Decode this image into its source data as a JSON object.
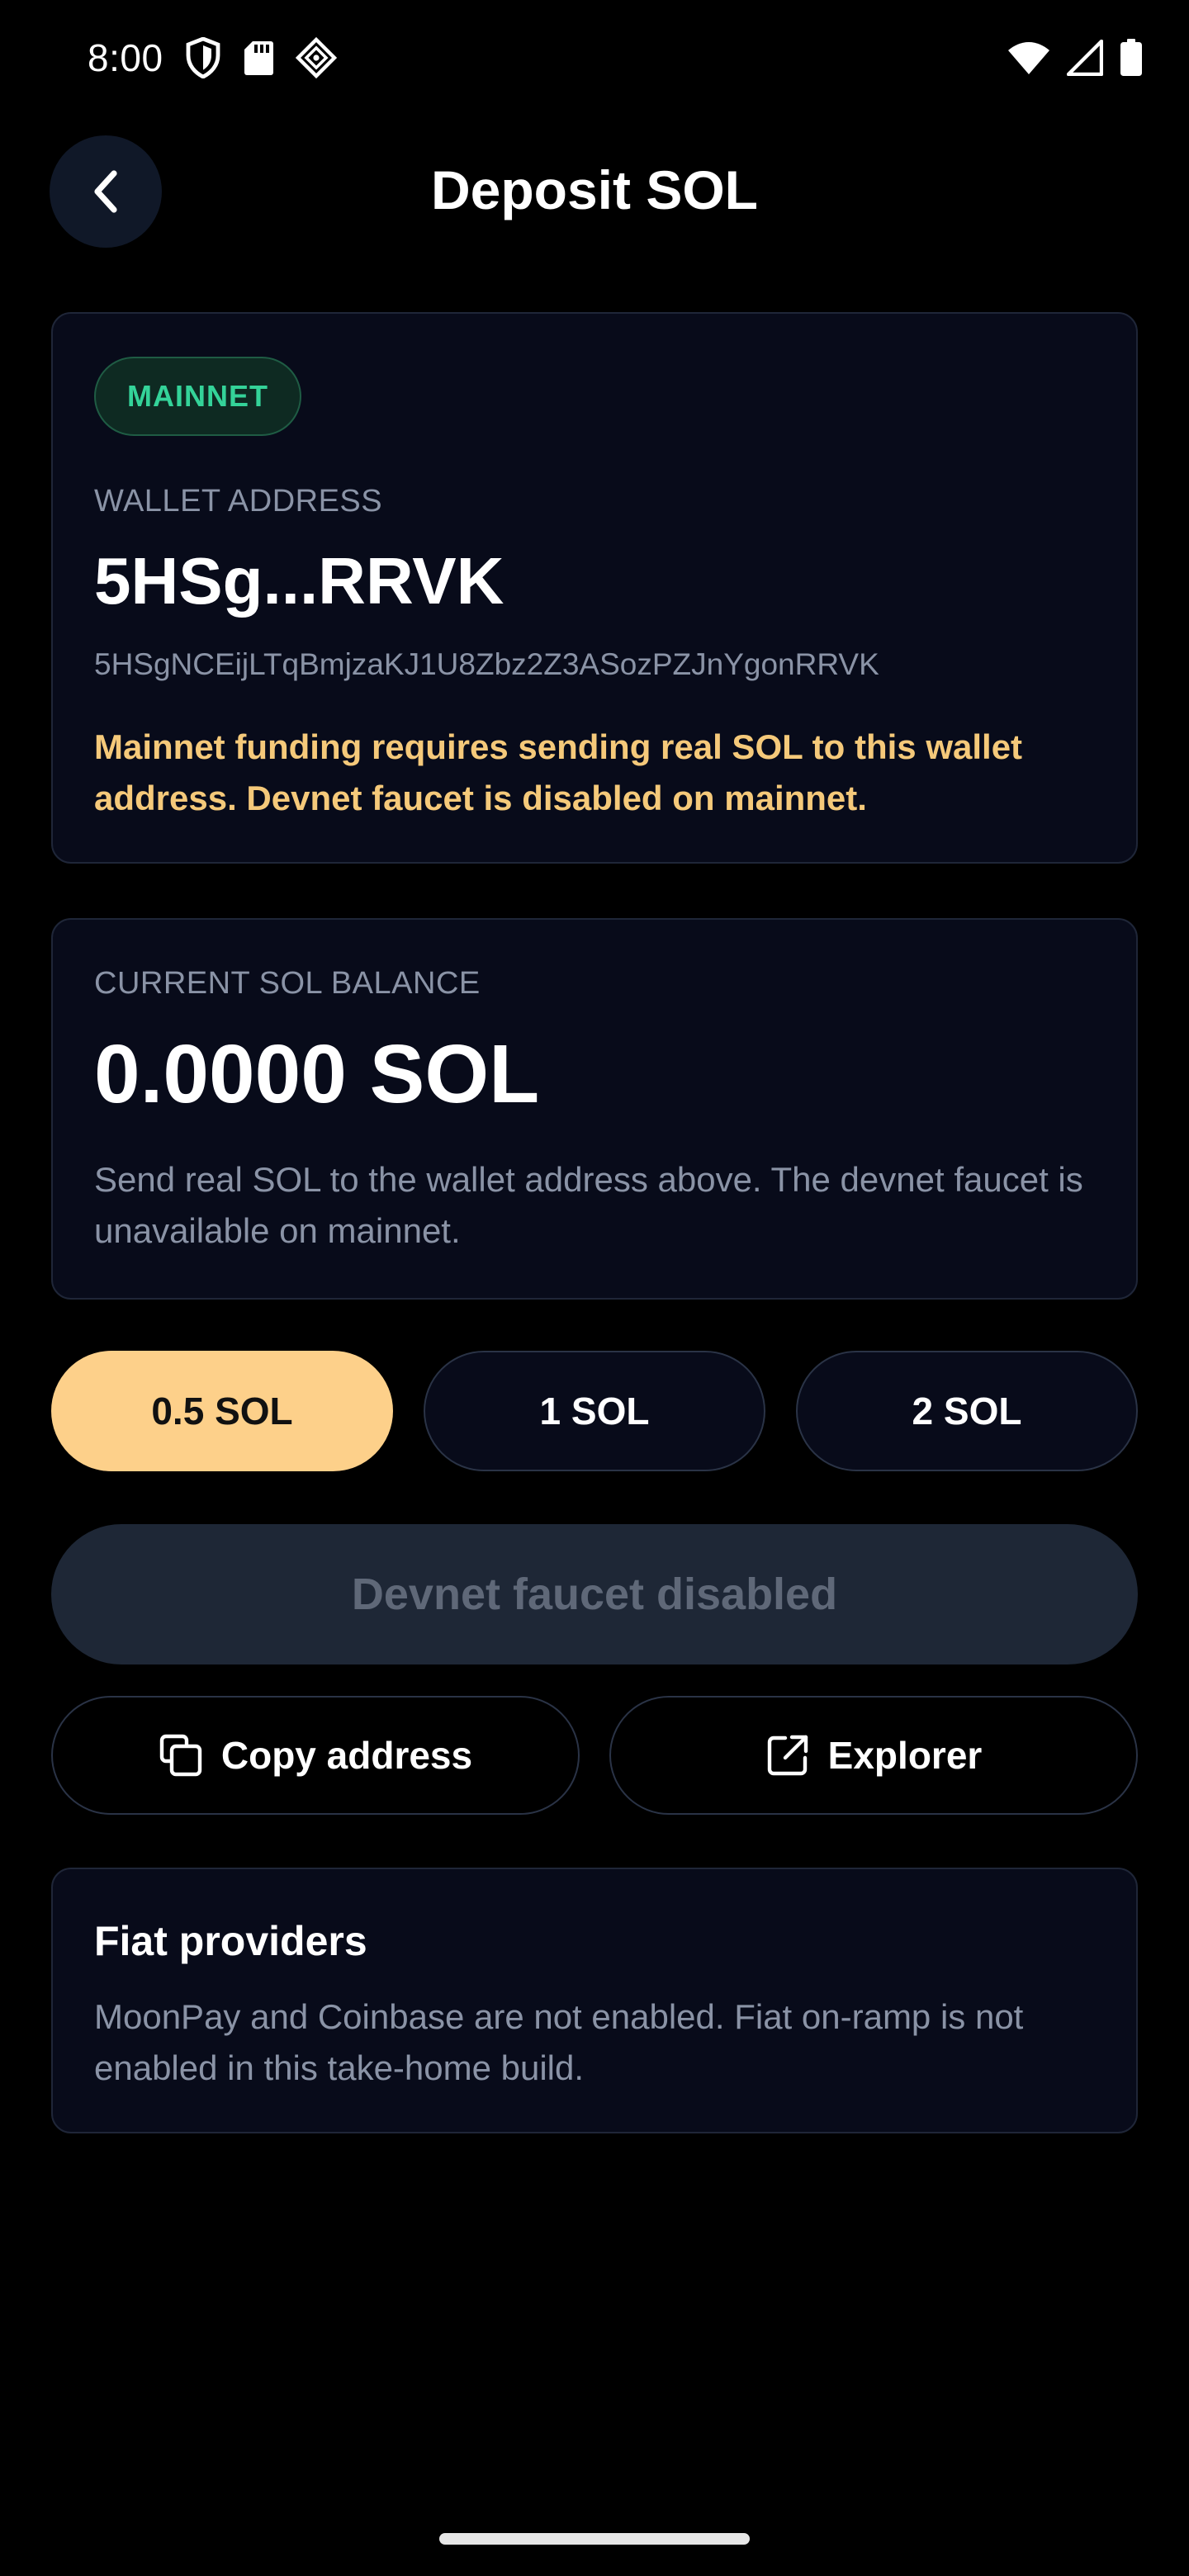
{
  "status_bar": {
    "time": "8:00"
  },
  "header": {
    "title": "Deposit SOL"
  },
  "wallet_card": {
    "network_badge": "MAINNET",
    "address_caption": "WALLET ADDRESS",
    "address_short": "5HSg...RRVK",
    "address_full": "5HSgNCEijLTqBmjzaKJ1U8Zbz2Z3ASozPZJnYgonRRVK",
    "warning": "Mainnet funding requires sending real SOL to this wallet address. Devnet faucet is disabled on mainnet."
  },
  "balance_card": {
    "caption": "CURRENT SOL BALANCE",
    "value": "0.0000 SOL",
    "help": "Send real SOL to the wallet address above. The devnet faucet is unavailable on mainnet."
  },
  "amount_options": {
    "selected": "0.5 SOL",
    "items": [
      "0.5 SOL",
      "1 SOL",
      "2 SOL"
    ]
  },
  "faucet_button": {
    "label": "Devnet faucet disabled"
  },
  "actions": {
    "copy_label": "Copy address",
    "explorer_label": "Explorer"
  },
  "fiat_card": {
    "title": "Fiat providers",
    "text": "MoonPay and Coinbase are not enabled. Fiat on-ramp is not enabled in this take-home build."
  },
  "colors": {
    "background": "#000000",
    "card": "#080b1a",
    "accent": "#fdd08a",
    "warning": "#f5c97a",
    "network_green": "#34d399",
    "muted": "#8a93a6"
  }
}
